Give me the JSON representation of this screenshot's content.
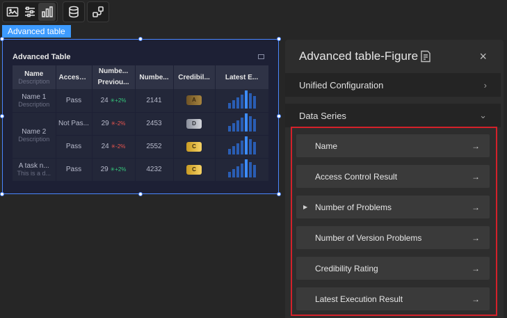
{
  "toolbar": {
    "buttons": [
      "image-icon",
      "sliders-icon",
      "bar-chart-icon",
      "database-icon",
      "workflow-icon"
    ]
  },
  "component": {
    "tag": "Advanced table",
    "title": "Advanced Table"
  },
  "table": {
    "headers": {
      "name": "Name",
      "name_desc": "Description",
      "access": "Access ...",
      "problems": "Numbe... Previou...",
      "version": "Numbe...",
      "credibility": "Credibil...",
      "latest": "Latest E..."
    },
    "rows": [
      {
        "name": "Name 1",
        "desc": "Description",
        "access": "Pass",
        "num": "24",
        "trend_symbol": "✳",
        "trend": "+2%",
        "version": "2141",
        "badge": "A"
      },
      {
        "name": "Name 2",
        "desc": "Description",
        "access": "Not Pas...",
        "num": "29",
        "trend_symbol": "✳",
        "trend": "-2%",
        "version": "2453",
        "badge": "D"
      },
      {
        "access": "Pass",
        "num": "24",
        "trend_symbol": "✳",
        "trend": "-2%",
        "version": "2552",
        "badge": "C"
      },
      {
        "name": "A task n...",
        "desc": "This is a d...",
        "access": "Pass",
        "num": "29",
        "trend_symbol": "✳",
        "trend": "+2%",
        "version": "4232",
        "badge": "C"
      }
    ]
  },
  "panel": {
    "title": "Advanced table-Figure",
    "close": "×",
    "sections": {
      "unified": "Unified Configuration",
      "series": "Data Series"
    },
    "series_items": [
      {
        "label": "Name",
        "arrow": "→"
      },
      {
        "label": "Access Control Result",
        "arrow": "→"
      },
      {
        "label": "Number of Problems",
        "arrow": "→",
        "caret": "▶"
      },
      {
        "label": "Number of Version Problems",
        "arrow": "→"
      },
      {
        "label": "Credibility Rating",
        "arrow": "→"
      },
      {
        "label": "Latest Execution Result",
        "arrow": "→"
      }
    ],
    "chevron_right": "›",
    "chevron_down": "⌄"
  },
  "colors": {
    "accent": "#3d9bff",
    "highlight_border": "#d4212a",
    "trend_up": "#35c87c",
    "trend_down": "#e8554e"
  }
}
